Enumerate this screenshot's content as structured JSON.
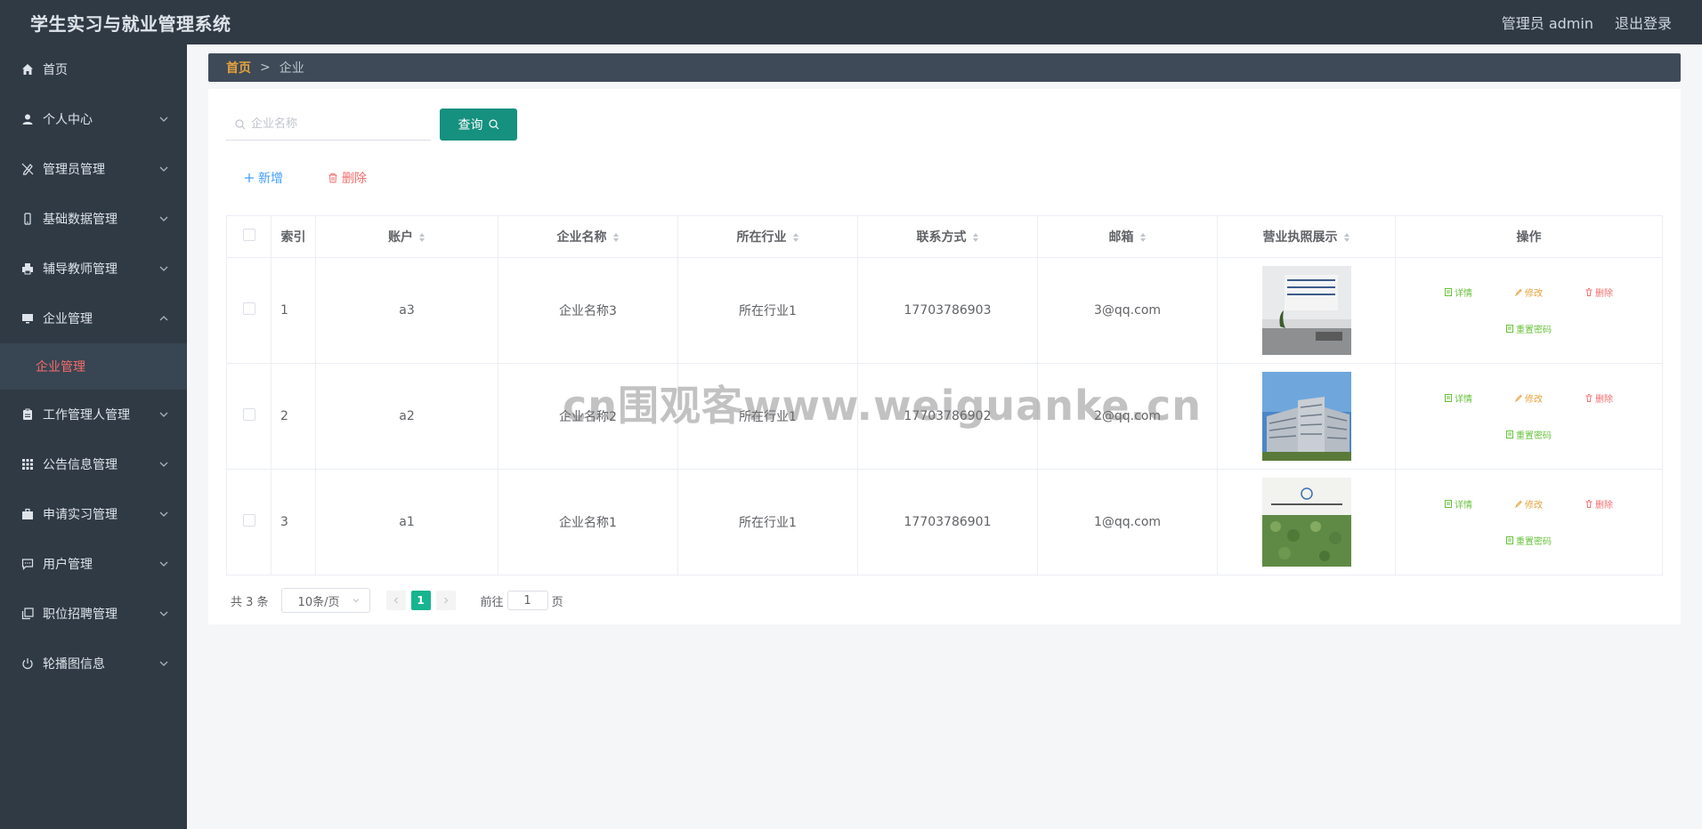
{
  "app": {
    "title": "学生实习与就业管理系统",
    "user_label": "管理员 admin",
    "logout_label": "退出登录"
  },
  "sidebar": {
    "items": [
      {
        "label": "首页",
        "icon": "home-icon"
      },
      {
        "label": "个人中心",
        "icon": "user-icon"
      },
      {
        "label": "管理员管理",
        "icon": "pen-off-icon"
      },
      {
        "label": "基础数据管理",
        "icon": "phone-icon"
      },
      {
        "label": "辅导教师管理",
        "icon": "printer-icon"
      },
      {
        "label": "企业管理",
        "icon": "monitor-icon"
      },
      {
        "label": "工作管理人管理",
        "icon": "clipboard-icon"
      },
      {
        "label": "公告信息管理",
        "icon": "grid-icon"
      },
      {
        "label": "申请实习管理",
        "icon": "briefcase-icon"
      },
      {
        "label": "用户管理",
        "icon": "chat-icon"
      },
      {
        "label": "职位招聘管理",
        "icon": "copy-icon"
      },
      {
        "label": "轮播图信息",
        "icon": "power-icon"
      }
    ],
    "active_sub": "企业管理"
  },
  "breadcrumb": {
    "home": "首页",
    "sep": ">",
    "current": "企业"
  },
  "search": {
    "placeholder": "企业名称",
    "button": "查询"
  },
  "actions": {
    "add": "新增",
    "delete": "删除"
  },
  "table": {
    "headers": [
      "索引",
      "账户",
      "企业名称",
      "所在行业",
      "联系方式",
      "邮箱",
      "营业执照展示",
      "操作"
    ],
    "rows": [
      {
        "index": "1",
        "account": "a3",
        "name": "企业名称3",
        "industry": "所在行业1",
        "phone": "17703786903",
        "email": "3@qq.com"
      },
      {
        "index": "2",
        "account": "a2",
        "name": "企业名称2",
        "industry": "所在行业1",
        "phone": "17703786902",
        "email": "2@qq.com"
      },
      {
        "index": "3",
        "account": "a1",
        "name": "企业名称1",
        "industry": "所在行业1",
        "phone": "17703786901",
        "email": "1@qq.com"
      }
    ],
    "ops": {
      "detail": "详情",
      "edit": "修改",
      "delete": "删除",
      "reset": "重置密码"
    }
  },
  "pager": {
    "total": "共 3 条",
    "page_size": "10条/页",
    "current": "1",
    "goto_label": "前往",
    "goto_value": "1",
    "page_unit": "页"
  },
  "watermark": "cn围观客www.weiguanke.cn",
  "colors": {
    "sidebar": "#2f3a45",
    "primary": "#16907f",
    "active": "#f56c6c"
  }
}
